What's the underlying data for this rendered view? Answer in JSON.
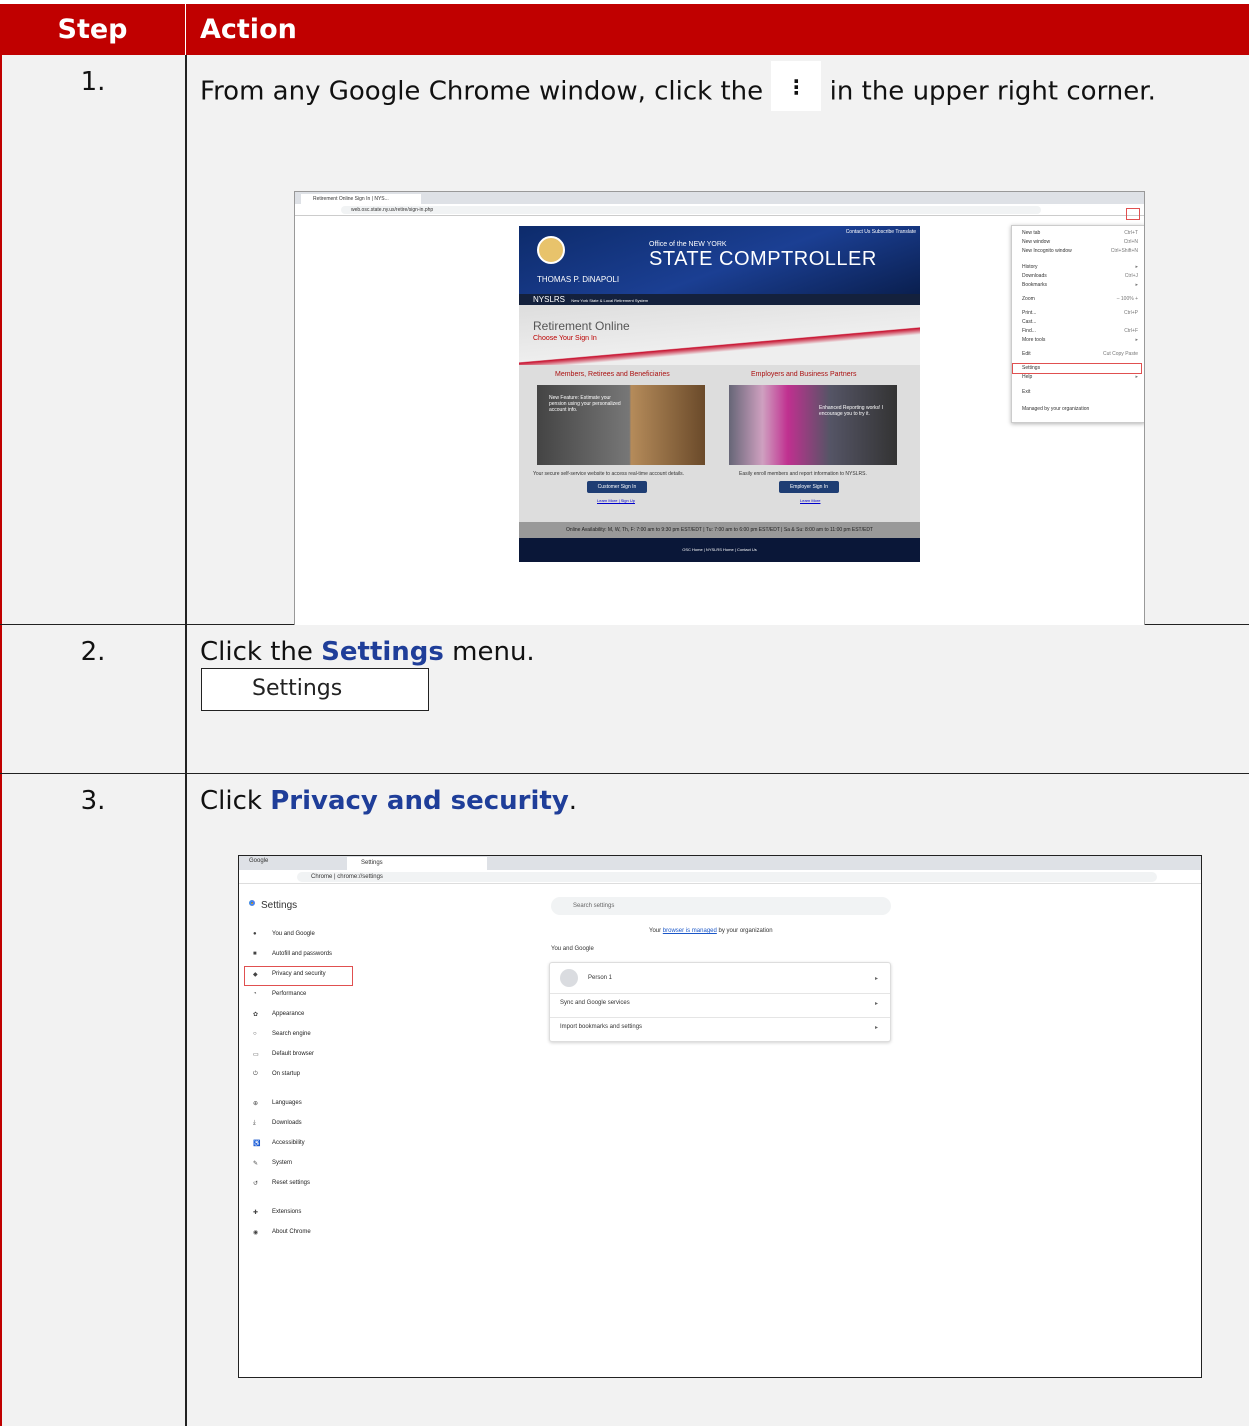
{
  "header": {
    "step": "Step",
    "action": "Action"
  },
  "steps": [
    {
      "num": "1.",
      "text_before": "From any Google Chrome window, click the",
      "text_after": "in the upper right corner.",
      "icon": "three-dot-menu-icon"
    },
    {
      "num": "2.",
      "text_before": "Click the",
      "bold": "Settings",
      "text_after": "menu.",
      "button_label": "Settings"
    },
    {
      "num": "3.",
      "text_before": "Click",
      "bold": "Privacy and security",
      "text_after": "."
    }
  ],
  "shot1": {
    "tab_title": "Retirement Online Sign In | NYS...",
    "url": "web.osc.state.ny.us/retire/sign-in.php",
    "top_links": "Contact Us   Subscribe   Translate",
    "office": "Office of the NEW YORK",
    "comptroller": "STATE COMPTROLLER",
    "name": "THOMAS P. DiNAPOLI",
    "nyslrs": "NYSLRS",
    "nyslrs_full": "New York State & Local Retirement System",
    "ro_title": "Retirement Online",
    "ro_sub": "Choose Your Sign In",
    "col1_title": "Members, Retirees and Beneficiaries",
    "col2_title": "Employers and Business Partners",
    "col1_cap": "New Feature: Estimate your pension using your personalized account info.",
    "col2_cap": "Enhanced Reporting works! I encourage you to try it.",
    "col1_desc": "Your secure self-service website to access real-time account details.",
    "col2_desc": "Easily enroll members and report information to NYSLRS.",
    "col1_btn": "Customer Sign In",
    "col2_btn": "Employer Sign In",
    "col1_links": "Learn More | Sign Up",
    "col2_links": "Learn More",
    "availability": "Online Availability: M, W, Th, F: 7:00 am to 9:30 pm EST/EDT | Tu: 7:00 am to 6:00 pm EST/EDT | Sa & Su: 8:00 am to 11:00 pm EST/EDT",
    "footer": "OSC Home | NYSLRS Home | Contact Us",
    "menu": [
      {
        "label": "New tab",
        "key": "Ctrl+T"
      },
      {
        "label": "New window",
        "key": "Ctrl+N"
      },
      {
        "label": "New Incognito window",
        "key": "Ctrl+Shift+N"
      },
      {
        "label": "History",
        "key": "▸"
      },
      {
        "label": "Downloads",
        "key": "Ctrl+J"
      },
      {
        "label": "Bookmarks",
        "key": "▸"
      },
      {
        "label": "Zoom",
        "key": "–  100%  +"
      },
      {
        "label": "Print...",
        "key": "Ctrl+P"
      },
      {
        "label": "Cast...",
        "key": ""
      },
      {
        "label": "Find...",
        "key": "Ctrl+F"
      },
      {
        "label": "More tools",
        "key": "▸"
      },
      {
        "label": "Edit",
        "key": "Cut  Copy  Paste"
      },
      {
        "label": "Settings",
        "key": ""
      },
      {
        "label": "Help",
        "key": "▸"
      },
      {
        "label": "Exit",
        "key": ""
      },
      {
        "label": "Managed by your organization",
        "key": ""
      }
    ]
  },
  "shot3": {
    "tab1": "Google",
    "tab2": "Settings",
    "url": "Chrome  |  chrome://settings",
    "title": "Settings",
    "search_placeholder": "Search settings",
    "managed_pre": "Your",
    "managed_link": "browser is managed",
    "managed_post": "by your organization",
    "section": "You and Google",
    "card_rows": [
      "Person 1",
      "Sync and Google services",
      "Import bookmarks and settings"
    ],
    "nav": [
      "You and Google",
      "Autofill and passwords",
      "Privacy and security",
      "Performance",
      "Appearance",
      "Search engine",
      "Default browser",
      "On startup",
      "Languages",
      "Downloads",
      "Accessibility",
      "System",
      "Reset settings",
      "Extensions",
      "About Chrome"
    ]
  },
  "colors": {
    "header_red": "#c00000",
    "link_blue": "#1f3e99"
  }
}
